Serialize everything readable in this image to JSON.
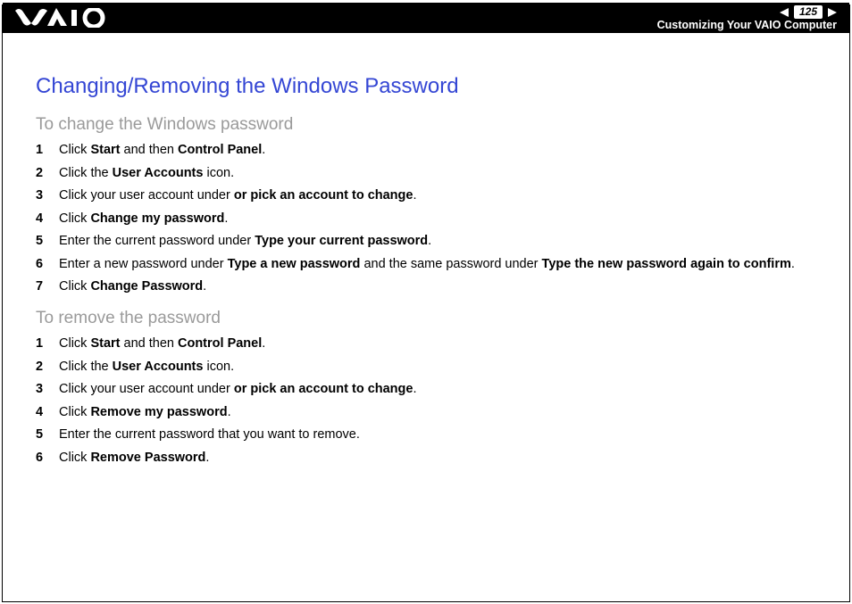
{
  "header": {
    "page_number": "125",
    "section": "Customizing Your VAIO Computer"
  },
  "title": "Changing/Removing the Windows Password",
  "section1": {
    "heading": "To change the Windows password",
    "steps": [
      "Click <b>Start</b> and then <b>Control Panel</b>.",
      "Click the <b>User Accounts</b> icon.",
      "Click your user account under <b>or pick an account to change</b>.",
      "Click <b>Change my password</b>.",
      "Enter the current password under <b>Type your current password</b>.",
      "Enter a new password under <b>Type a new password</b> and the same password under <b>Type the new password again to confirm</b>.",
      "Click <b>Change Password</b>."
    ]
  },
  "section2": {
    "heading": "To remove the password",
    "steps": [
      "Click <b>Start</b> and then <b>Control Panel</b>.",
      "Click the <b>User Accounts</b> icon.",
      "Click your user account under <b>or pick an account to change</b>.",
      "Click <b>Remove my password</b>.",
      "Enter the current password that you want to remove.",
      "Click <b>Remove Password</b>."
    ]
  }
}
